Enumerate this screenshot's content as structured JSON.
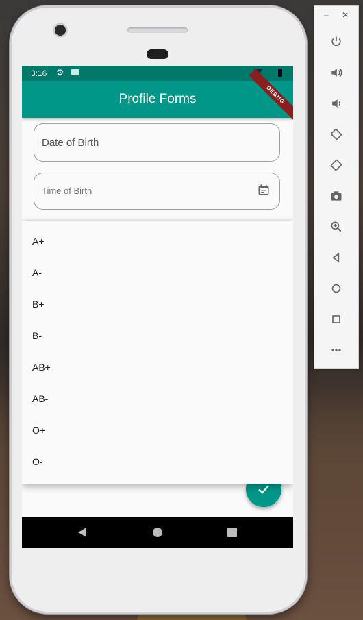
{
  "status_bar": {
    "time": "3:16"
  },
  "app_bar": {
    "title": "Profile Forms",
    "debug_label": "DEBUG"
  },
  "form": {
    "date_of_birth": {
      "label": "Date of Birth"
    },
    "time_of_birth": {
      "label": "Time of Birth"
    }
  },
  "blood_group_menu": {
    "options": [
      "A+",
      "A-",
      "B+",
      "B-",
      "AB+",
      "AB-",
      "O+",
      "O-"
    ]
  },
  "fab": {
    "icon": "check-icon"
  },
  "nav_bar": {
    "icons": [
      "back-icon",
      "home-icon",
      "recents-icon"
    ]
  },
  "emulator_toolbar": {
    "minimize_label": "–",
    "close_label": "✕",
    "icons": [
      "power-icon",
      "volume-up-icon",
      "volume-down-icon",
      "rotate-left-icon",
      "rotate-right-icon",
      "screenshot-icon",
      "zoom-icon",
      "back-icon",
      "home-icon",
      "overview-icon",
      "more-icon"
    ]
  },
  "colors": {
    "primary": "#009688",
    "primary_dark": "#00796b",
    "debug": "#8b1f1f"
  }
}
